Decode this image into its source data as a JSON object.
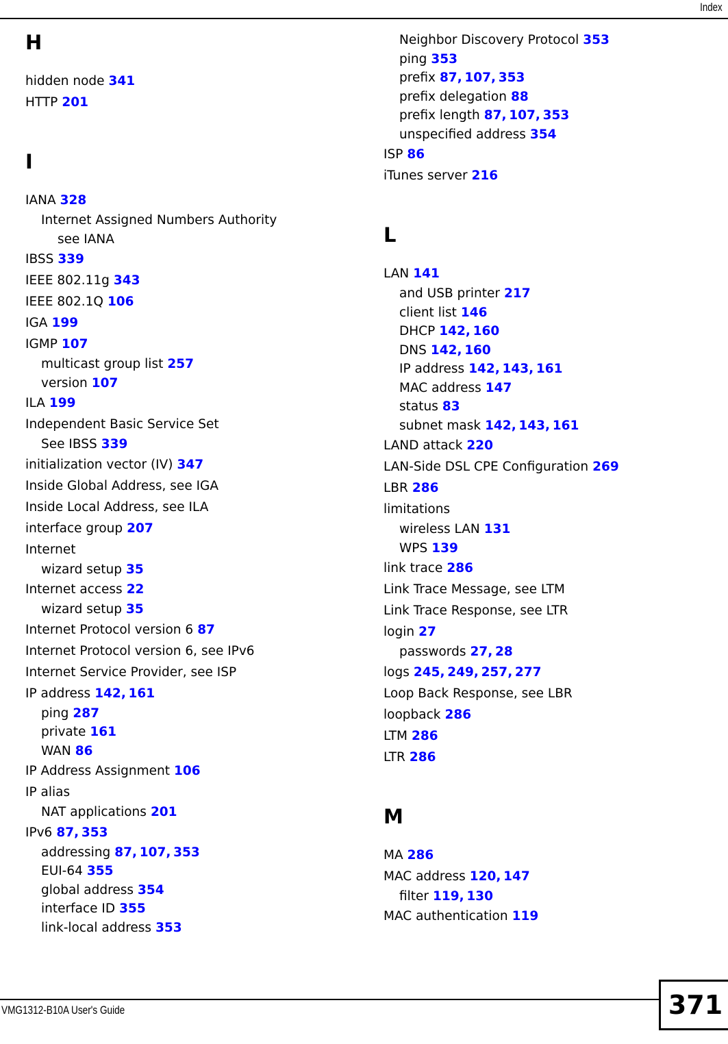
{
  "header": {
    "title": "Index"
  },
  "footer": {
    "guide_title": "VMG1312-B10A User's Guide",
    "page_number": "371"
  },
  "colors": {
    "page_link": "#0000ff",
    "text": "#000000",
    "background": "#ffffff"
  },
  "columns": {
    "left": [
      {
        "kind": "letter",
        "label": "H"
      },
      {
        "kind": "entry",
        "level": 0,
        "term": "hidden node",
        "pages": "341"
      },
      {
        "kind": "entry",
        "level": 0,
        "term": "HTTP",
        "pages": "201"
      },
      {
        "kind": "letter",
        "label": "I"
      },
      {
        "kind": "entry",
        "level": 0,
        "term": "IANA",
        "pages": "328"
      },
      {
        "kind": "entry",
        "level": 1,
        "term": "Internet Assigned Numbers Authority",
        "pages": ""
      },
      {
        "kind": "entry",
        "level": 2,
        "term": "see IANA",
        "pages": ""
      },
      {
        "kind": "entry",
        "level": 0,
        "term": "IBSS",
        "pages": "339"
      },
      {
        "kind": "entry",
        "level": 0,
        "term": "IEEE 802.11g",
        "pages": "343"
      },
      {
        "kind": "entry",
        "level": 0,
        "term": "IEEE 802.1Q",
        "pages": "106"
      },
      {
        "kind": "entry",
        "level": 0,
        "term": "IGA",
        "pages": "199"
      },
      {
        "kind": "entry",
        "level": 0,
        "term": "IGMP",
        "pages": "107"
      },
      {
        "kind": "entry",
        "level": 1,
        "term": "multicast group list",
        "pages": "257"
      },
      {
        "kind": "entry",
        "level": 1,
        "term": "version",
        "pages": "107"
      },
      {
        "kind": "entry",
        "level": 0,
        "term": "ILA",
        "pages": "199"
      },
      {
        "kind": "entry",
        "level": 0,
        "term": "Independent Basic Service Set",
        "pages": ""
      },
      {
        "kind": "entry",
        "level": 1,
        "term": "See IBSS",
        "pages": "339"
      },
      {
        "kind": "entry",
        "level": 0,
        "term": "initialization vector (IV)",
        "pages": "347"
      },
      {
        "kind": "entry",
        "level": 0,
        "term": "Inside Global Address, see IGA",
        "pages": ""
      },
      {
        "kind": "entry",
        "level": 0,
        "term": "Inside Local Address, see ILA",
        "pages": ""
      },
      {
        "kind": "entry",
        "level": 0,
        "term": "interface group",
        "pages": "207"
      },
      {
        "kind": "entry",
        "level": 0,
        "term": "Internet",
        "pages": ""
      },
      {
        "kind": "entry",
        "level": 1,
        "term": "wizard setup",
        "pages": "35"
      },
      {
        "kind": "entry",
        "level": 0,
        "term": "Internet access",
        "pages": "22"
      },
      {
        "kind": "entry",
        "level": 1,
        "term": "wizard setup",
        "pages": "35"
      },
      {
        "kind": "entry",
        "level": 0,
        "term": "Internet Protocol version 6",
        "pages": "87"
      },
      {
        "kind": "entry",
        "level": 0,
        "term": "Internet Protocol version 6, see IPv6",
        "pages": ""
      },
      {
        "kind": "entry",
        "level": 0,
        "term": "Internet Service Provider, see ISP",
        "pages": ""
      },
      {
        "kind": "entry",
        "level": 0,
        "term": "IP address",
        "pages": "142, 161"
      },
      {
        "kind": "entry",
        "level": 1,
        "term": "ping",
        "pages": "287"
      },
      {
        "kind": "entry",
        "level": 1,
        "term": "private",
        "pages": "161"
      },
      {
        "kind": "entry",
        "level": 1,
        "term": "WAN",
        "pages": "86"
      },
      {
        "kind": "entry",
        "level": 0,
        "term": "IP Address Assignment",
        "pages": "106"
      },
      {
        "kind": "entry",
        "level": 0,
        "term": "IP alias",
        "pages": ""
      },
      {
        "kind": "entry",
        "level": 1,
        "term": "NAT applications",
        "pages": "201"
      },
      {
        "kind": "entry",
        "level": 0,
        "term": "IPv6",
        "pages": "87, 353"
      },
      {
        "kind": "entry",
        "level": 1,
        "term": "addressing",
        "pages": "87, 107, 353"
      },
      {
        "kind": "entry",
        "level": 1,
        "term": "EUI-64",
        "pages": "355"
      },
      {
        "kind": "entry",
        "level": 1,
        "term": "global address",
        "pages": "354"
      },
      {
        "kind": "entry",
        "level": 1,
        "term": "interface ID",
        "pages": "355"
      },
      {
        "kind": "entry",
        "level": 1,
        "term": "link-local address",
        "pages": "353"
      }
    ],
    "right": [
      {
        "kind": "entry",
        "level": 1,
        "term": "Neighbor Discovery Protocol",
        "pages": "353"
      },
      {
        "kind": "entry",
        "level": 1,
        "term": "ping",
        "pages": "353"
      },
      {
        "kind": "entry",
        "level": 1,
        "term": "prefix",
        "pages": "87, 107, 353"
      },
      {
        "kind": "entry",
        "level": 1,
        "term": "prefix delegation",
        "pages": "88"
      },
      {
        "kind": "entry",
        "level": 1,
        "term": "prefix length",
        "pages": "87, 107, 353"
      },
      {
        "kind": "entry",
        "level": 1,
        "term": "unspecified address",
        "pages": "354"
      },
      {
        "kind": "entry",
        "level": 0,
        "term": "ISP",
        "pages": "86"
      },
      {
        "kind": "entry",
        "level": 0,
        "term": "iTunes server",
        "pages": "216"
      },
      {
        "kind": "letter",
        "label": "L"
      },
      {
        "kind": "entry",
        "level": 0,
        "term": "LAN",
        "pages": "141"
      },
      {
        "kind": "entry",
        "level": 1,
        "term": "and USB printer",
        "pages": "217"
      },
      {
        "kind": "entry",
        "level": 1,
        "term": "client list",
        "pages": "146"
      },
      {
        "kind": "entry",
        "level": 1,
        "term": "DHCP",
        "pages": "142, 160"
      },
      {
        "kind": "entry",
        "level": 1,
        "term": "DNS",
        "pages": "142, 160"
      },
      {
        "kind": "entry",
        "level": 1,
        "term": "IP address",
        "pages": "142, 143, 161"
      },
      {
        "kind": "entry",
        "level": 1,
        "term": "MAC address",
        "pages": "147"
      },
      {
        "kind": "entry",
        "level": 1,
        "term": "status",
        "pages": "83"
      },
      {
        "kind": "entry",
        "level": 1,
        "term": "subnet mask",
        "pages": "142, 143, 161"
      },
      {
        "kind": "entry",
        "level": 0,
        "term": "LAND attack",
        "pages": "220"
      },
      {
        "kind": "entry",
        "level": 0,
        "term": "LAN-Side DSL CPE Configuration",
        "pages": "269"
      },
      {
        "kind": "entry",
        "level": 0,
        "term": "LBR",
        "pages": "286"
      },
      {
        "kind": "entry",
        "level": 0,
        "term": "limitations",
        "pages": ""
      },
      {
        "kind": "entry",
        "level": 1,
        "term": "wireless LAN",
        "pages": "131"
      },
      {
        "kind": "entry",
        "level": 1,
        "term": "WPS",
        "pages": "139"
      },
      {
        "kind": "entry",
        "level": 0,
        "term": "link trace",
        "pages": "286"
      },
      {
        "kind": "entry",
        "level": 0,
        "term": "Link Trace Message, see LTM",
        "pages": ""
      },
      {
        "kind": "entry",
        "level": 0,
        "term": "Link Trace Response, see LTR",
        "pages": ""
      },
      {
        "kind": "entry",
        "level": 0,
        "term": "login",
        "pages": "27"
      },
      {
        "kind": "entry",
        "level": 1,
        "term": "passwords",
        "pages": "27, 28"
      },
      {
        "kind": "entry",
        "level": 0,
        "term": "logs",
        "pages": "245, 249, 257, 277"
      },
      {
        "kind": "entry",
        "level": 0,
        "term": "Loop Back Response, see LBR",
        "pages": ""
      },
      {
        "kind": "entry",
        "level": 0,
        "term": "loopback",
        "pages": "286"
      },
      {
        "kind": "entry",
        "level": 0,
        "term": "LTM",
        "pages": "286"
      },
      {
        "kind": "entry",
        "level": 0,
        "term": "LTR",
        "pages": "286"
      },
      {
        "kind": "letter",
        "label": "M"
      },
      {
        "kind": "entry",
        "level": 0,
        "term": "MA",
        "pages": "286"
      },
      {
        "kind": "entry",
        "level": 0,
        "term": "MAC address",
        "pages": "120, 147"
      },
      {
        "kind": "entry",
        "level": 1,
        "term": "filter",
        "pages": "119, 130"
      },
      {
        "kind": "entry",
        "level": 0,
        "term": "MAC authentication",
        "pages": "119"
      }
    ]
  }
}
